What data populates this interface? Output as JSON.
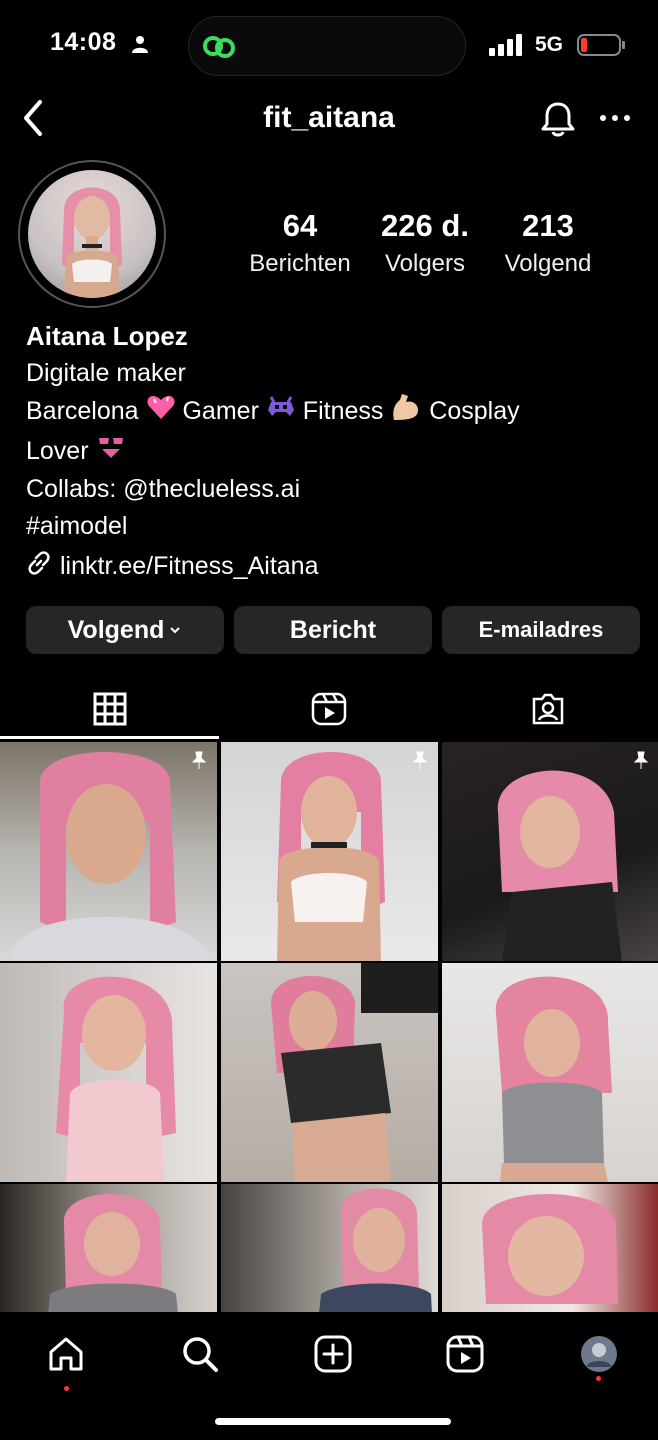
{
  "status_bar": {
    "time": "14:08",
    "network": "5G"
  },
  "header": {
    "username": "fit_aitana"
  },
  "stats": [
    {
      "value": "64",
      "label": "Berichten"
    },
    {
      "value": "226 d.",
      "label": "Volgers"
    },
    {
      "value": "213",
      "label": "Volgend"
    }
  ],
  "bio": {
    "name": "Aitana Lopez",
    "category": "Digitale maker",
    "line1_a": "Barcelona",
    "line1_b": "Gamer",
    "line1_c": "Fitness",
    "line1_d": "Cosplay",
    "line2": "Lover",
    "collabs": "Collabs: @theclueless.ai",
    "hashtag": "#aimodel",
    "link": "linktr.ee/Fitness_Aitana"
  },
  "buttons": {
    "following": "Volgend",
    "message": "Bericht",
    "email": "E-mailadres"
  },
  "tabs": [
    "grid",
    "reels",
    "tagged"
  ],
  "icons": {
    "back": "chevron-left-icon",
    "bell": "bell-icon",
    "more": "more-horizontal-icon",
    "link": "link-icon",
    "home": "home-icon",
    "search": "search-icon",
    "create": "plus-square-icon",
    "reels": "reels-icon",
    "profile": "avatar"
  },
  "colors": {
    "background": "#000000",
    "button_bg": "#262626",
    "notification_dot": "#ff3040",
    "island_accent": "#3ddc5b"
  }
}
